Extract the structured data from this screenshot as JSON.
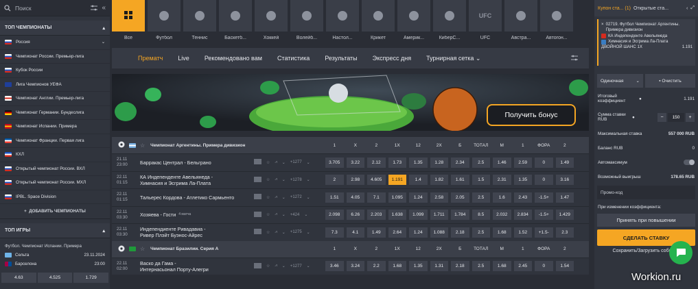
{
  "search": {
    "placeholder": "Поиск"
  },
  "top_champ": {
    "title": "ТОП ЧЕМПИОНАТЫ",
    "items": [
      {
        "label": "Россия",
        "c1": "#ffffff",
        "c2": "#1c57c8",
        "c3": "#d52b1e"
      },
      {
        "label": "Чемпионат России. Премьер-лига",
        "c1": "#ffffff",
        "c2": "#1c57c8",
        "c3": "#d52b1e"
      },
      {
        "label": "Кубок России",
        "c1": "#ffffff",
        "c2": "#1c57c8",
        "c3": "#d52b1e"
      },
      {
        "label": "Лига Чемпионов УЕФА",
        "c1": "#1f3f9a",
        "c2": "#1f3f9a",
        "c3": "#1f3f9a"
      },
      {
        "label": "Чемпионат Англии. Премьер-лига",
        "c1": "#ffffff",
        "c2": "#d52b1e",
        "c3": "#ffffff"
      },
      {
        "label": "Чемпионат Германии. Бундеслига",
        "c1": "#111111",
        "c2": "#dd0000",
        "c3": "#ffce00"
      },
      {
        "label": "Чемпионат Испании. Примера",
        "c1": "#c60b1e",
        "c2": "#ffc400",
        "c3": "#c60b1e"
      },
      {
        "label": "Чемпионат Франции. Первая лига",
        "c1": "#0055a4",
        "c2": "#ffffff",
        "c3": "#ef4135"
      },
      {
        "label": "КХЛ",
        "c1": "#1c57c8",
        "c2": "#ffffff",
        "c3": "#d52b1e"
      },
      {
        "label": "Открытый чемпионат России. ВХЛ",
        "c1": "#ffffff",
        "c2": "#1c57c8",
        "c3": "#d52b1e"
      },
      {
        "label": "Открытый чемпионат России. МХЛ",
        "c1": "#ffffff",
        "c2": "#1c57c8",
        "c3": "#d52b1e"
      },
      {
        "label": "IPBL. Space Division",
        "c1": "#ffffff",
        "c2": "#1c57c8",
        "c3": "#d52b1e"
      }
    ],
    "add_label": "ДОБАВИТЬ ЧЕМПИОНАТЫ"
  },
  "top_games": {
    "title": "ТОП ИГРЫ",
    "league": "Футбол. Чемпионат Испании. Примера",
    "team1": "Сельта",
    "date": "23.11.2024",
    "team2": "Барселона",
    "time": "23:00",
    "odds": [
      "4.63",
      "4.525",
      "1.729"
    ]
  },
  "sports": [
    {
      "label": "Все",
      "icon": "grid-icon"
    },
    {
      "label": "Футбол",
      "icon": "football-icon"
    },
    {
      "label": "Теннис",
      "icon": "tennis-icon"
    },
    {
      "label": "Баскетб...",
      "icon": "basketball-icon"
    },
    {
      "label": "Хоккей",
      "icon": "hockey-icon"
    },
    {
      "label": "Волейб...",
      "icon": "volleyball-icon"
    },
    {
      "label": "Настол...",
      "icon": "table-tennis-icon"
    },
    {
      "label": "Крикет",
      "icon": "cricket-icon"
    },
    {
      "label": "Америк...",
      "icon": "american-football-icon"
    },
    {
      "label": "КиберС...",
      "icon": "esports-icon"
    },
    {
      "label": "UFC",
      "icon": "ufc-icon"
    },
    {
      "label": "Австра...",
      "icon": "aussie-rules-icon"
    },
    {
      "label": "Автогон...",
      "icon": "motorsport-icon"
    }
  ],
  "nav": [
    "Прематч",
    "Live",
    "Рекомендовано вам",
    "Статистика",
    "Результаты",
    "Экспресс дня",
    "Турнирная сетка"
  ],
  "banner": {
    "button": "Получить бонус"
  },
  "leagues": [
    {
      "name": "Чемпионат Аргентины. Примера дивизион",
      "cols": [
        "1",
        "X",
        "2",
        "1X",
        "12",
        "2X",
        "Б",
        "ТОТАЛ",
        "М",
        "1",
        "ФОРА",
        "2"
      ],
      "rows": [
        {
          "d": "21.11",
          "t": "23:00",
          "m1": "Барракас Централ - Бельграно",
          "m2": "",
          "extra": "+1277",
          "odds": [
            "3.705",
            "3.22",
            "2.12",
            "1.73",
            "1.35",
            "1.28",
            "2.34",
            "2.5",
            "1.46",
            "2.59",
            "0",
            "1.49"
          ]
        },
        {
          "d": "22.11",
          "t": "01:15",
          "m1": "КА Индепенденте Авельянеда -",
          "m2": "Химнасия и Эсгрима Ла-Плата",
          "extra": "+1278",
          "odds": [
            "2",
            "2.98",
            "4.605",
            "1.191",
            "1.4",
            "1.82",
            "1.61",
            "1.5",
            "2.31",
            "1.35",
            "0",
            "3.16"
          ]
        },
        {
          "d": "22.11",
          "t": "01:15",
          "m1": "Тальерес Кордова - Атлетико Сармьенто",
          "m2": "",
          "extra": "+1272",
          "odds": [
            "1.51",
            "4.05",
            "7.1",
            "1.095",
            "1.24",
            "2.58",
            "2.05",
            "2.5",
            "1.6",
            "2.43",
            "-1.5+",
            "1.47"
          ]
        },
        {
          "d": "22.11",
          "t": "03:30",
          "m1": "Хозяева - Гости",
          "m2": "",
          "live": "4 матча",
          "extra": "+424",
          "odds": [
            "2.098",
            "6.26",
            "2.203",
            "1.638",
            "1.099",
            "1.711",
            "1.784",
            "8.5",
            "2.032",
            "2.834",
            "-1.5+",
            "1.429"
          ]
        },
        {
          "d": "22.11",
          "t": "03:30",
          "m1": "Индепендиенте Ривадавиа -",
          "m2": "Ривер Плэйт Буэнос-Айрес",
          "extra": "+1275",
          "odds": [
            "7.3",
            "4.1",
            "1.49",
            "2.64",
            "1.24",
            "1.088",
            "2.18",
            "2.5",
            "1.68",
            "1.52",
            "+1.5-",
            "2.3"
          ]
        }
      ]
    },
    {
      "name": "Чемпионат Бразилии. Серия А",
      "cols": [
        "1",
        "X",
        "2",
        "1X",
        "12",
        "2X",
        "Б",
        "ТОТАЛ",
        "М",
        "1",
        "ФОРА",
        "2"
      ],
      "rows": [
        {
          "d": "22.11",
          "t": "02:00",
          "m1": "Васко да Гама -",
          "m2": "Интернасьонал Порту-Алегри",
          "extra": "+1277",
          "odds": [
            "3.46",
            "3.24",
            "2.2",
            "1.68",
            "1.35",
            "1.31",
            "2.18",
            "2.5",
            "1.68",
            "2.45",
            "0",
            "1.54"
          ]
        }
      ]
    }
  ],
  "coupon": {
    "tab1": "Купон ста...",
    "count": "(1)",
    "tab2": "Открытые ста...",
    "match_id": "02719. Футбол Чемпионат Аргентины. Примера дивизион",
    "team1": "КА Индепенденте Авельянеда",
    "team2": "Химнасия и Эсгрима Ла-Плата",
    "bet": "ДВОЙНОЙ ШАНС 1X",
    "odd": "1.191",
    "type": "Одиночная",
    "clear": "Очистить",
    "total_label": "Итоговый коэффициент",
    "total": "1.191",
    "stake_label": "Сумма ставки RUB",
    "stake": "150",
    "max_label": "Максимальная ставка",
    "max": "557 000 RUB",
    "balance_label": "Баланс RUB",
    "balance": "0",
    "automax_label": "Автомаксимум",
    "win_label": "Возможный выигрыш",
    "win": "178.65 RUB",
    "promo": "Промо-код",
    "change_label": "При изменении коэффициента:",
    "change_value": "Принять при повышении",
    "make_bet": "СДЕЛАТЬ СТАВКУ",
    "save_load": "Сохранить/Загрузить события"
  },
  "watermark": "Workion.ru"
}
